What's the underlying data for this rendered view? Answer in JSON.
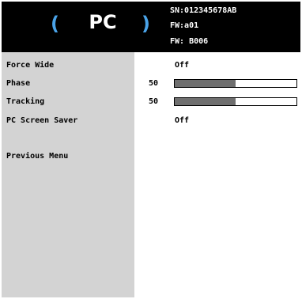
{
  "header": {
    "paren_left": "(",
    "title": "PC",
    "paren_right": ")",
    "serial": "SN:012345678AB",
    "fw_line1": "FW:a01",
    "fw_line2": "FW: B006",
    "accent_color": "#4aa3e8"
  },
  "menu": {
    "items": [
      {
        "label": "Force Wide",
        "value": "Off"
      },
      {
        "label": "Phase",
        "number": "50",
        "level_percent": 50
      },
      {
        "label": "Tracking",
        "number": "50",
        "level_percent": 50
      },
      {
        "label": "PC Screen Saver",
        "value": "Off"
      },
      {
        "label": "Previous Menu"
      }
    ]
  }
}
